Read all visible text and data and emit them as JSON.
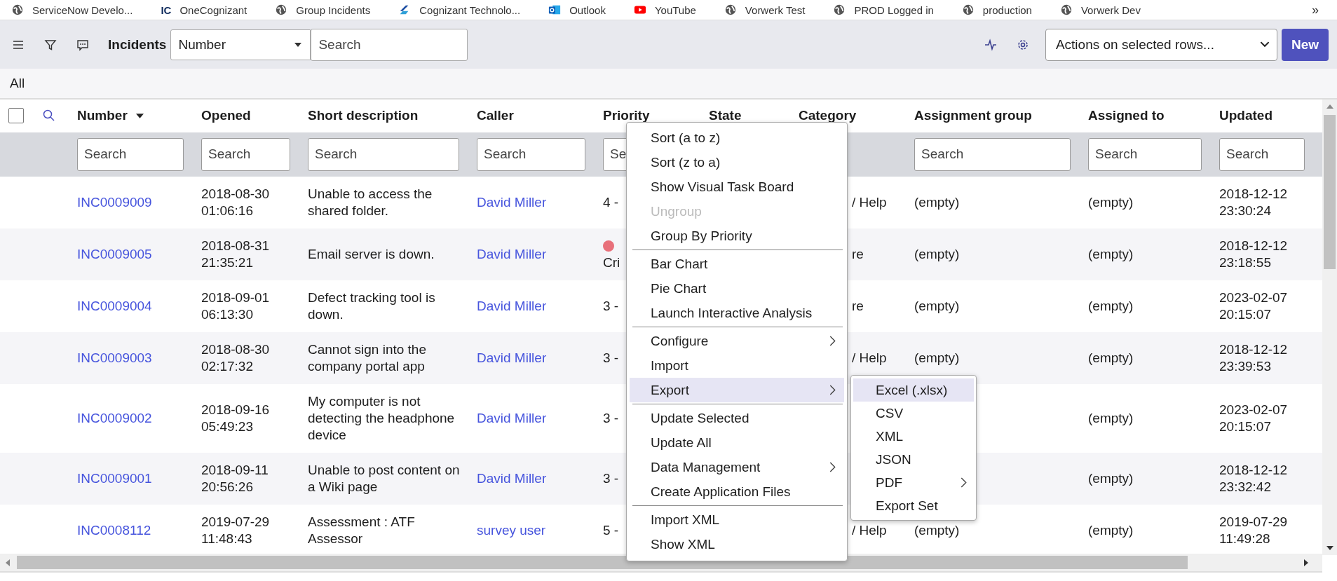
{
  "bookmarks": [
    {
      "label": "ServiceNow Develo...",
      "kind": "globe"
    },
    {
      "label": "OneCognizant",
      "kind": "ic",
      "logo": "IC"
    },
    {
      "label": "Group Incidents",
      "kind": "globe"
    },
    {
      "label": "Cognizant Technolo...",
      "kind": "cognizant"
    },
    {
      "label": "Outlook",
      "kind": "outlook"
    },
    {
      "label": "YouTube",
      "kind": "youtube"
    },
    {
      "label": "Vorwerk Test",
      "kind": "globe"
    },
    {
      "label": "PROD Logged in",
      "kind": "globe"
    },
    {
      "label": "production",
      "kind": "globe"
    },
    {
      "label": "Vorwerk Dev",
      "kind": "globe"
    }
  ],
  "bookmarks_more": "»",
  "toolbar": {
    "title": "Incidents",
    "field": "Number",
    "search_placeholder": "Search",
    "actions": "Actions on selected rows...",
    "new_button": "New"
  },
  "breadcrumb": "All",
  "select_all": {
    "checked": false
  },
  "columns": [
    {
      "label": "Number",
      "sorted": true,
      "placeholder": "Search"
    },
    {
      "label": "Opened",
      "sorted": false,
      "placeholder": "Search"
    },
    {
      "label": "Short description",
      "sorted": false,
      "placeholder": "Search"
    },
    {
      "label": "Caller",
      "sorted": false,
      "placeholder": "Search"
    },
    {
      "label": "Priority",
      "sorted": false,
      "placeholder": "Se"
    },
    {
      "label": "State",
      "sorted": false
    },
    {
      "label": "Category",
      "sorted": false
    },
    {
      "label": "Assignment group",
      "sorted": false,
      "placeholder": "Search"
    },
    {
      "label": "Assigned to",
      "sorted": false,
      "placeholder": "Search"
    },
    {
      "label": "Updated",
      "sorted": false,
      "placeholder": "Search"
    }
  ],
  "rows": [
    {
      "number": "INC0009009",
      "opened": "2018-08-30 01:06:16",
      "description": "Unable to access the shared folder.",
      "caller": "David Miller",
      "priority": {
        "text": "4 -"
      },
      "category": "/ Help",
      "assignment_group": "(empty)",
      "assigned_to": "(empty)",
      "updated": "2018-12-12 23:30:24"
    },
    {
      "number": "INC0009005",
      "opened": "2018-08-31 21:35:21",
      "description": "Email server is down.",
      "caller": "David Miller",
      "priority": {
        "text": "Cri",
        "color": "#e8707a"
      },
      "category": "re",
      "assignment_group": "(empty)",
      "assigned_to": "(empty)",
      "updated": "2018-12-12 23:18:55"
    },
    {
      "number": "INC0009004",
      "opened": "2018-09-01 06:13:30",
      "description": "Defect tracking tool is down.",
      "caller": "David Miller",
      "priority": {
        "text": "3 -"
      },
      "category": "re",
      "assignment_group": "(empty)",
      "assigned_to": "(empty)",
      "updated": "2023-02-07 20:15:07"
    },
    {
      "number": "INC0009003",
      "opened": "2018-08-30 02:17:32",
      "description": "Cannot sign into the company portal app",
      "caller": "David Miller",
      "priority": {
        "text": "3 -"
      },
      "category": "/ Help",
      "assignment_group": "(empty)",
      "assigned_to": "(empty)",
      "updated": "2018-12-12 23:39:53"
    },
    {
      "number": "INC0009002",
      "opened": "2018-09-16 05:49:23",
      "description": "My computer is not detecting the headphone device",
      "caller": "David Miller",
      "priority": {
        "text": "3 -"
      },
      "assigned_to": "(empty)",
      "updated": "2023-02-07 20:15:07"
    },
    {
      "number": "INC0009001",
      "opened": "2018-09-11 20:56:26",
      "description": "Unable to post content on a Wiki page",
      "caller": "David Miller",
      "priority": {
        "text": "3 -"
      },
      "assigned_to": "(empty)",
      "updated": "2018-12-12 23:32:42"
    },
    {
      "number": "INC0008112",
      "opened": "2019-07-29 11:48:43",
      "description": "Assessment : ATF Assessor",
      "caller": "survey user",
      "priority": {
        "text": "5 -"
      },
      "category": "/ Help",
      "assignment_group": "(empty)",
      "assigned_to": "(empty)",
      "updated": "2019-07-29 11:49:28"
    }
  ],
  "context_menu": {
    "groups": [
      [
        {
          "label": "Sort (a to z)",
          "disabled": false,
          "submenu": false,
          "selected": false
        },
        {
          "label": "Sort (z to a)",
          "disabled": false,
          "submenu": false,
          "selected": false
        },
        {
          "label": "Show Visual Task Board",
          "disabled": false,
          "submenu": false,
          "selected": false
        },
        {
          "label": "Ungroup",
          "disabled": true,
          "submenu": false,
          "selected": false
        },
        {
          "label": "Group By Priority",
          "disabled": false,
          "submenu": false,
          "selected": false
        }
      ],
      [
        {
          "label": "Bar Chart",
          "disabled": false,
          "submenu": false,
          "selected": false
        },
        {
          "label": "Pie Chart",
          "disabled": false,
          "submenu": false,
          "selected": false
        },
        {
          "label": "Launch Interactive Analysis",
          "disabled": false,
          "submenu": false,
          "selected": false
        }
      ],
      [
        {
          "label": "Configure",
          "disabled": false,
          "submenu": true,
          "selected": false
        },
        {
          "label": "Import",
          "disabled": false,
          "submenu": false,
          "selected": false
        },
        {
          "label": "Export",
          "disabled": false,
          "submenu": true,
          "selected": true
        }
      ],
      [
        {
          "label": "Update Selected",
          "disabled": false,
          "submenu": false,
          "selected": false
        },
        {
          "label": "Update All",
          "disabled": false,
          "submenu": false,
          "selected": false
        },
        {
          "label": "Data Management",
          "disabled": false,
          "submenu": true,
          "selected": false
        },
        {
          "label": "Create Application Files",
          "disabled": false,
          "submenu": false,
          "selected": false
        }
      ],
      [
        {
          "label": "Import XML",
          "disabled": false,
          "submenu": false,
          "selected": false
        },
        {
          "label": "Show XML",
          "disabled": false,
          "submenu": false,
          "selected": false
        }
      ]
    ],
    "submenu": [
      {
        "label": "Excel (.xlsx)",
        "submenu": false,
        "selected": true
      },
      {
        "label": "CSV",
        "submenu": false,
        "selected": false
      },
      {
        "label": "XML",
        "submenu": false,
        "selected": false
      },
      {
        "label": "JSON",
        "submenu": false,
        "selected": false
      },
      {
        "label": "PDF",
        "submenu": true,
        "selected": false
      },
      {
        "label": "Export Set",
        "submenu": false,
        "selected": false
      }
    ]
  }
}
